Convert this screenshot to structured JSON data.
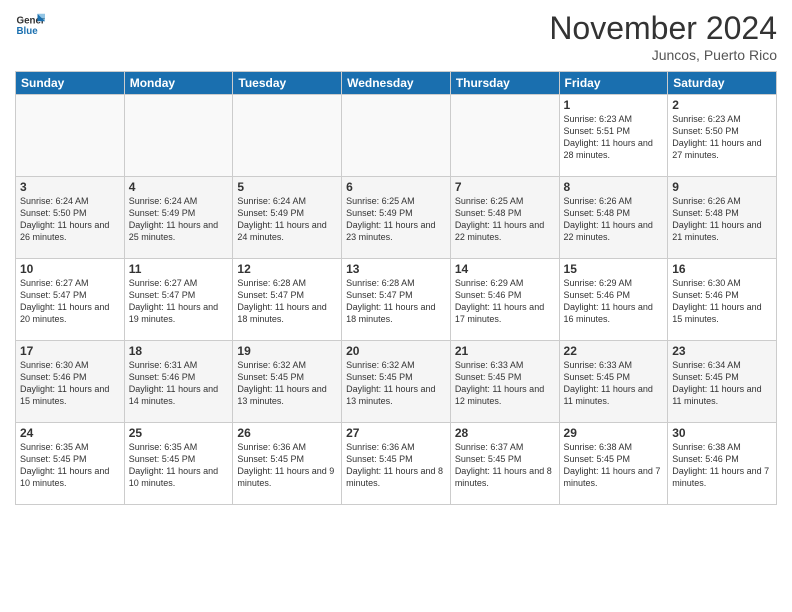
{
  "logo": {
    "line1": "General",
    "line2": "Blue"
  },
  "title": "November 2024",
  "subtitle": "Juncos, Puerto Rico",
  "days_header": [
    "Sunday",
    "Monday",
    "Tuesday",
    "Wednesday",
    "Thursday",
    "Friday",
    "Saturday"
  ],
  "weeks": [
    [
      {
        "day": "",
        "info": ""
      },
      {
        "day": "",
        "info": ""
      },
      {
        "day": "",
        "info": ""
      },
      {
        "day": "",
        "info": ""
      },
      {
        "day": "",
        "info": ""
      },
      {
        "day": "1",
        "info": "Sunrise: 6:23 AM\nSunset: 5:51 PM\nDaylight: 11 hours and 28 minutes."
      },
      {
        "day": "2",
        "info": "Sunrise: 6:23 AM\nSunset: 5:50 PM\nDaylight: 11 hours and 27 minutes."
      }
    ],
    [
      {
        "day": "3",
        "info": "Sunrise: 6:24 AM\nSunset: 5:50 PM\nDaylight: 11 hours and 26 minutes."
      },
      {
        "day": "4",
        "info": "Sunrise: 6:24 AM\nSunset: 5:49 PM\nDaylight: 11 hours and 25 minutes."
      },
      {
        "day": "5",
        "info": "Sunrise: 6:24 AM\nSunset: 5:49 PM\nDaylight: 11 hours and 24 minutes."
      },
      {
        "day": "6",
        "info": "Sunrise: 6:25 AM\nSunset: 5:49 PM\nDaylight: 11 hours and 23 minutes."
      },
      {
        "day": "7",
        "info": "Sunrise: 6:25 AM\nSunset: 5:48 PM\nDaylight: 11 hours and 22 minutes."
      },
      {
        "day": "8",
        "info": "Sunrise: 6:26 AM\nSunset: 5:48 PM\nDaylight: 11 hours and 22 minutes."
      },
      {
        "day": "9",
        "info": "Sunrise: 6:26 AM\nSunset: 5:48 PM\nDaylight: 11 hours and 21 minutes."
      }
    ],
    [
      {
        "day": "10",
        "info": "Sunrise: 6:27 AM\nSunset: 5:47 PM\nDaylight: 11 hours and 20 minutes."
      },
      {
        "day": "11",
        "info": "Sunrise: 6:27 AM\nSunset: 5:47 PM\nDaylight: 11 hours and 19 minutes."
      },
      {
        "day": "12",
        "info": "Sunrise: 6:28 AM\nSunset: 5:47 PM\nDaylight: 11 hours and 18 minutes."
      },
      {
        "day": "13",
        "info": "Sunrise: 6:28 AM\nSunset: 5:47 PM\nDaylight: 11 hours and 18 minutes."
      },
      {
        "day": "14",
        "info": "Sunrise: 6:29 AM\nSunset: 5:46 PM\nDaylight: 11 hours and 17 minutes."
      },
      {
        "day": "15",
        "info": "Sunrise: 6:29 AM\nSunset: 5:46 PM\nDaylight: 11 hours and 16 minutes."
      },
      {
        "day": "16",
        "info": "Sunrise: 6:30 AM\nSunset: 5:46 PM\nDaylight: 11 hours and 15 minutes."
      }
    ],
    [
      {
        "day": "17",
        "info": "Sunrise: 6:30 AM\nSunset: 5:46 PM\nDaylight: 11 hours and 15 minutes."
      },
      {
        "day": "18",
        "info": "Sunrise: 6:31 AM\nSunset: 5:46 PM\nDaylight: 11 hours and 14 minutes."
      },
      {
        "day": "19",
        "info": "Sunrise: 6:32 AM\nSunset: 5:45 PM\nDaylight: 11 hours and 13 minutes."
      },
      {
        "day": "20",
        "info": "Sunrise: 6:32 AM\nSunset: 5:45 PM\nDaylight: 11 hours and 13 minutes."
      },
      {
        "day": "21",
        "info": "Sunrise: 6:33 AM\nSunset: 5:45 PM\nDaylight: 11 hours and 12 minutes."
      },
      {
        "day": "22",
        "info": "Sunrise: 6:33 AM\nSunset: 5:45 PM\nDaylight: 11 hours and 11 minutes."
      },
      {
        "day": "23",
        "info": "Sunrise: 6:34 AM\nSunset: 5:45 PM\nDaylight: 11 hours and 11 minutes."
      }
    ],
    [
      {
        "day": "24",
        "info": "Sunrise: 6:35 AM\nSunset: 5:45 PM\nDaylight: 11 hours and 10 minutes."
      },
      {
        "day": "25",
        "info": "Sunrise: 6:35 AM\nSunset: 5:45 PM\nDaylight: 11 hours and 10 minutes."
      },
      {
        "day": "26",
        "info": "Sunrise: 6:36 AM\nSunset: 5:45 PM\nDaylight: 11 hours and 9 minutes."
      },
      {
        "day": "27",
        "info": "Sunrise: 6:36 AM\nSunset: 5:45 PM\nDaylight: 11 hours and 8 minutes."
      },
      {
        "day": "28",
        "info": "Sunrise: 6:37 AM\nSunset: 5:45 PM\nDaylight: 11 hours and 8 minutes."
      },
      {
        "day": "29",
        "info": "Sunrise: 6:38 AM\nSunset: 5:45 PM\nDaylight: 11 hours and 7 minutes."
      },
      {
        "day": "30",
        "info": "Sunrise: 6:38 AM\nSunset: 5:46 PM\nDaylight: 11 hours and 7 minutes."
      }
    ]
  ]
}
